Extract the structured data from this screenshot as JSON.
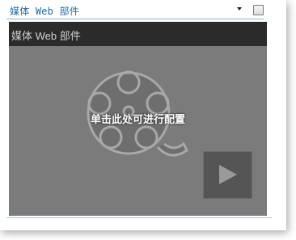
{
  "webpart": {
    "title": "媒体 Web 部件",
    "menu_icon": "dropdown-arrow-icon",
    "checkbox_checked": false
  },
  "player": {
    "title": "媒体 Web 部件",
    "configure_text": "单击此处可进行配置",
    "reel_icon": "film-reel-icon",
    "play_icon": "play-icon"
  }
}
